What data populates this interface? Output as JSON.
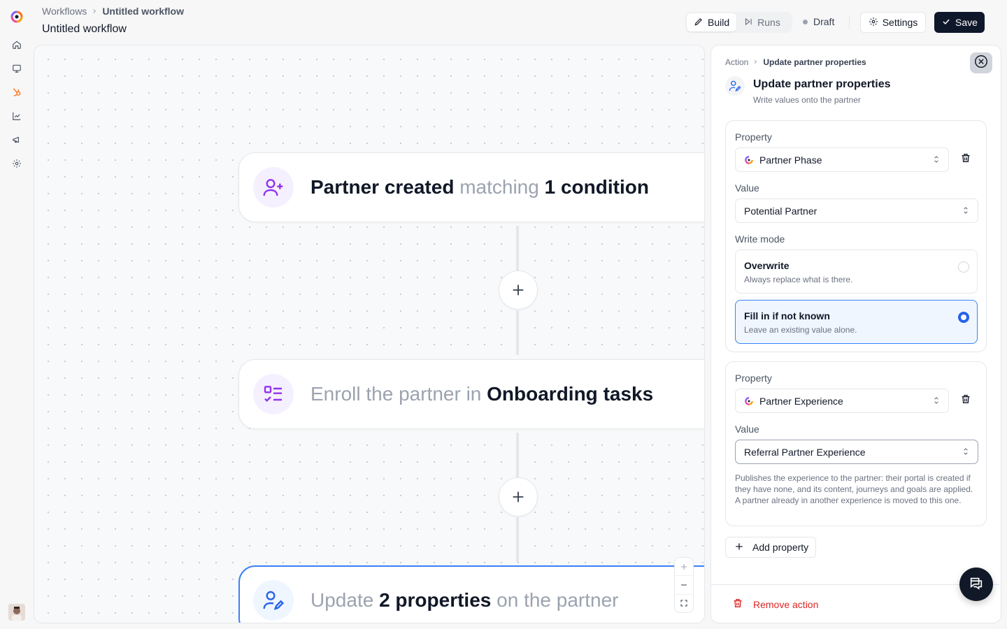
{
  "header": {
    "breadcrumb_root": "Workflows",
    "breadcrumb_current": "Untitled workflow",
    "title": "Untitled workflow",
    "tabs": [
      {
        "label": "Build",
        "active": true,
        "icon": "pencil-icon"
      },
      {
        "label": "Runs",
        "active": false,
        "icon": "play-step-icon"
      }
    ],
    "status": "Draft",
    "settings_label": "Settings",
    "save_label": "Save"
  },
  "sidebar": {
    "items": [
      {
        "name": "home-icon"
      },
      {
        "name": "monitor-icon"
      },
      {
        "name": "hubspot-icon"
      },
      {
        "name": "chart-icon"
      },
      {
        "name": "megaphone-icon"
      },
      {
        "name": "gear-icon"
      }
    ]
  },
  "canvas": {
    "trigger": {
      "a": "Partner created",
      "b": " matching ",
      "c": "1 condition"
    },
    "step1": {
      "a": "Enroll the partner in ",
      "b": "Onboarding tasks"
    },
    "step2": {
      "a": "Update ",
      "b": "2 properties",
      "c": " on the partner"
    }
  },
  "panel": {
    "breadcrumb_root": "Action",
    "breadcrumb_current": "Update partner properties",
    "title": "Update partner properties",
    "subtitle": "Write values onto the partner",
    "properties": [
      {
        "property_label": "Property",
        "property_value": "Partner Phase",
        "value_label": "Value",
        "value": "Potential Partner",
        "write_mode_label": "Write mode",
        "modes": [
          {
            "title": "Overwrite",
            "desc": "Always replace what is there.",
            "selected": false
          },
          {
            "title": "Fill in if not known",
            "desc": "Leave an existing value alone.",
            "selected": true
          }
        ]
      },
      {
        "property_label": "Property",
        "property_value": "Partner Experience",
        "value_label": "Value",
        "value": "Referral Partner Experience",
        "help": "Publishes the experience to the partner: their portal is created if they have none, and its content, journeys and goals are applied. A partner already in another experience is moved to this one."
      }
    ],
    "add_property_label": "Add property",
    "remove_action_label": "Remove action"
  },
  "colors": {
    "accent": "#2563eb",
    "primary_dark": "#0f172a",
    "danger": "#dc2626",
    "purple": "#9333ea"
  }
}
